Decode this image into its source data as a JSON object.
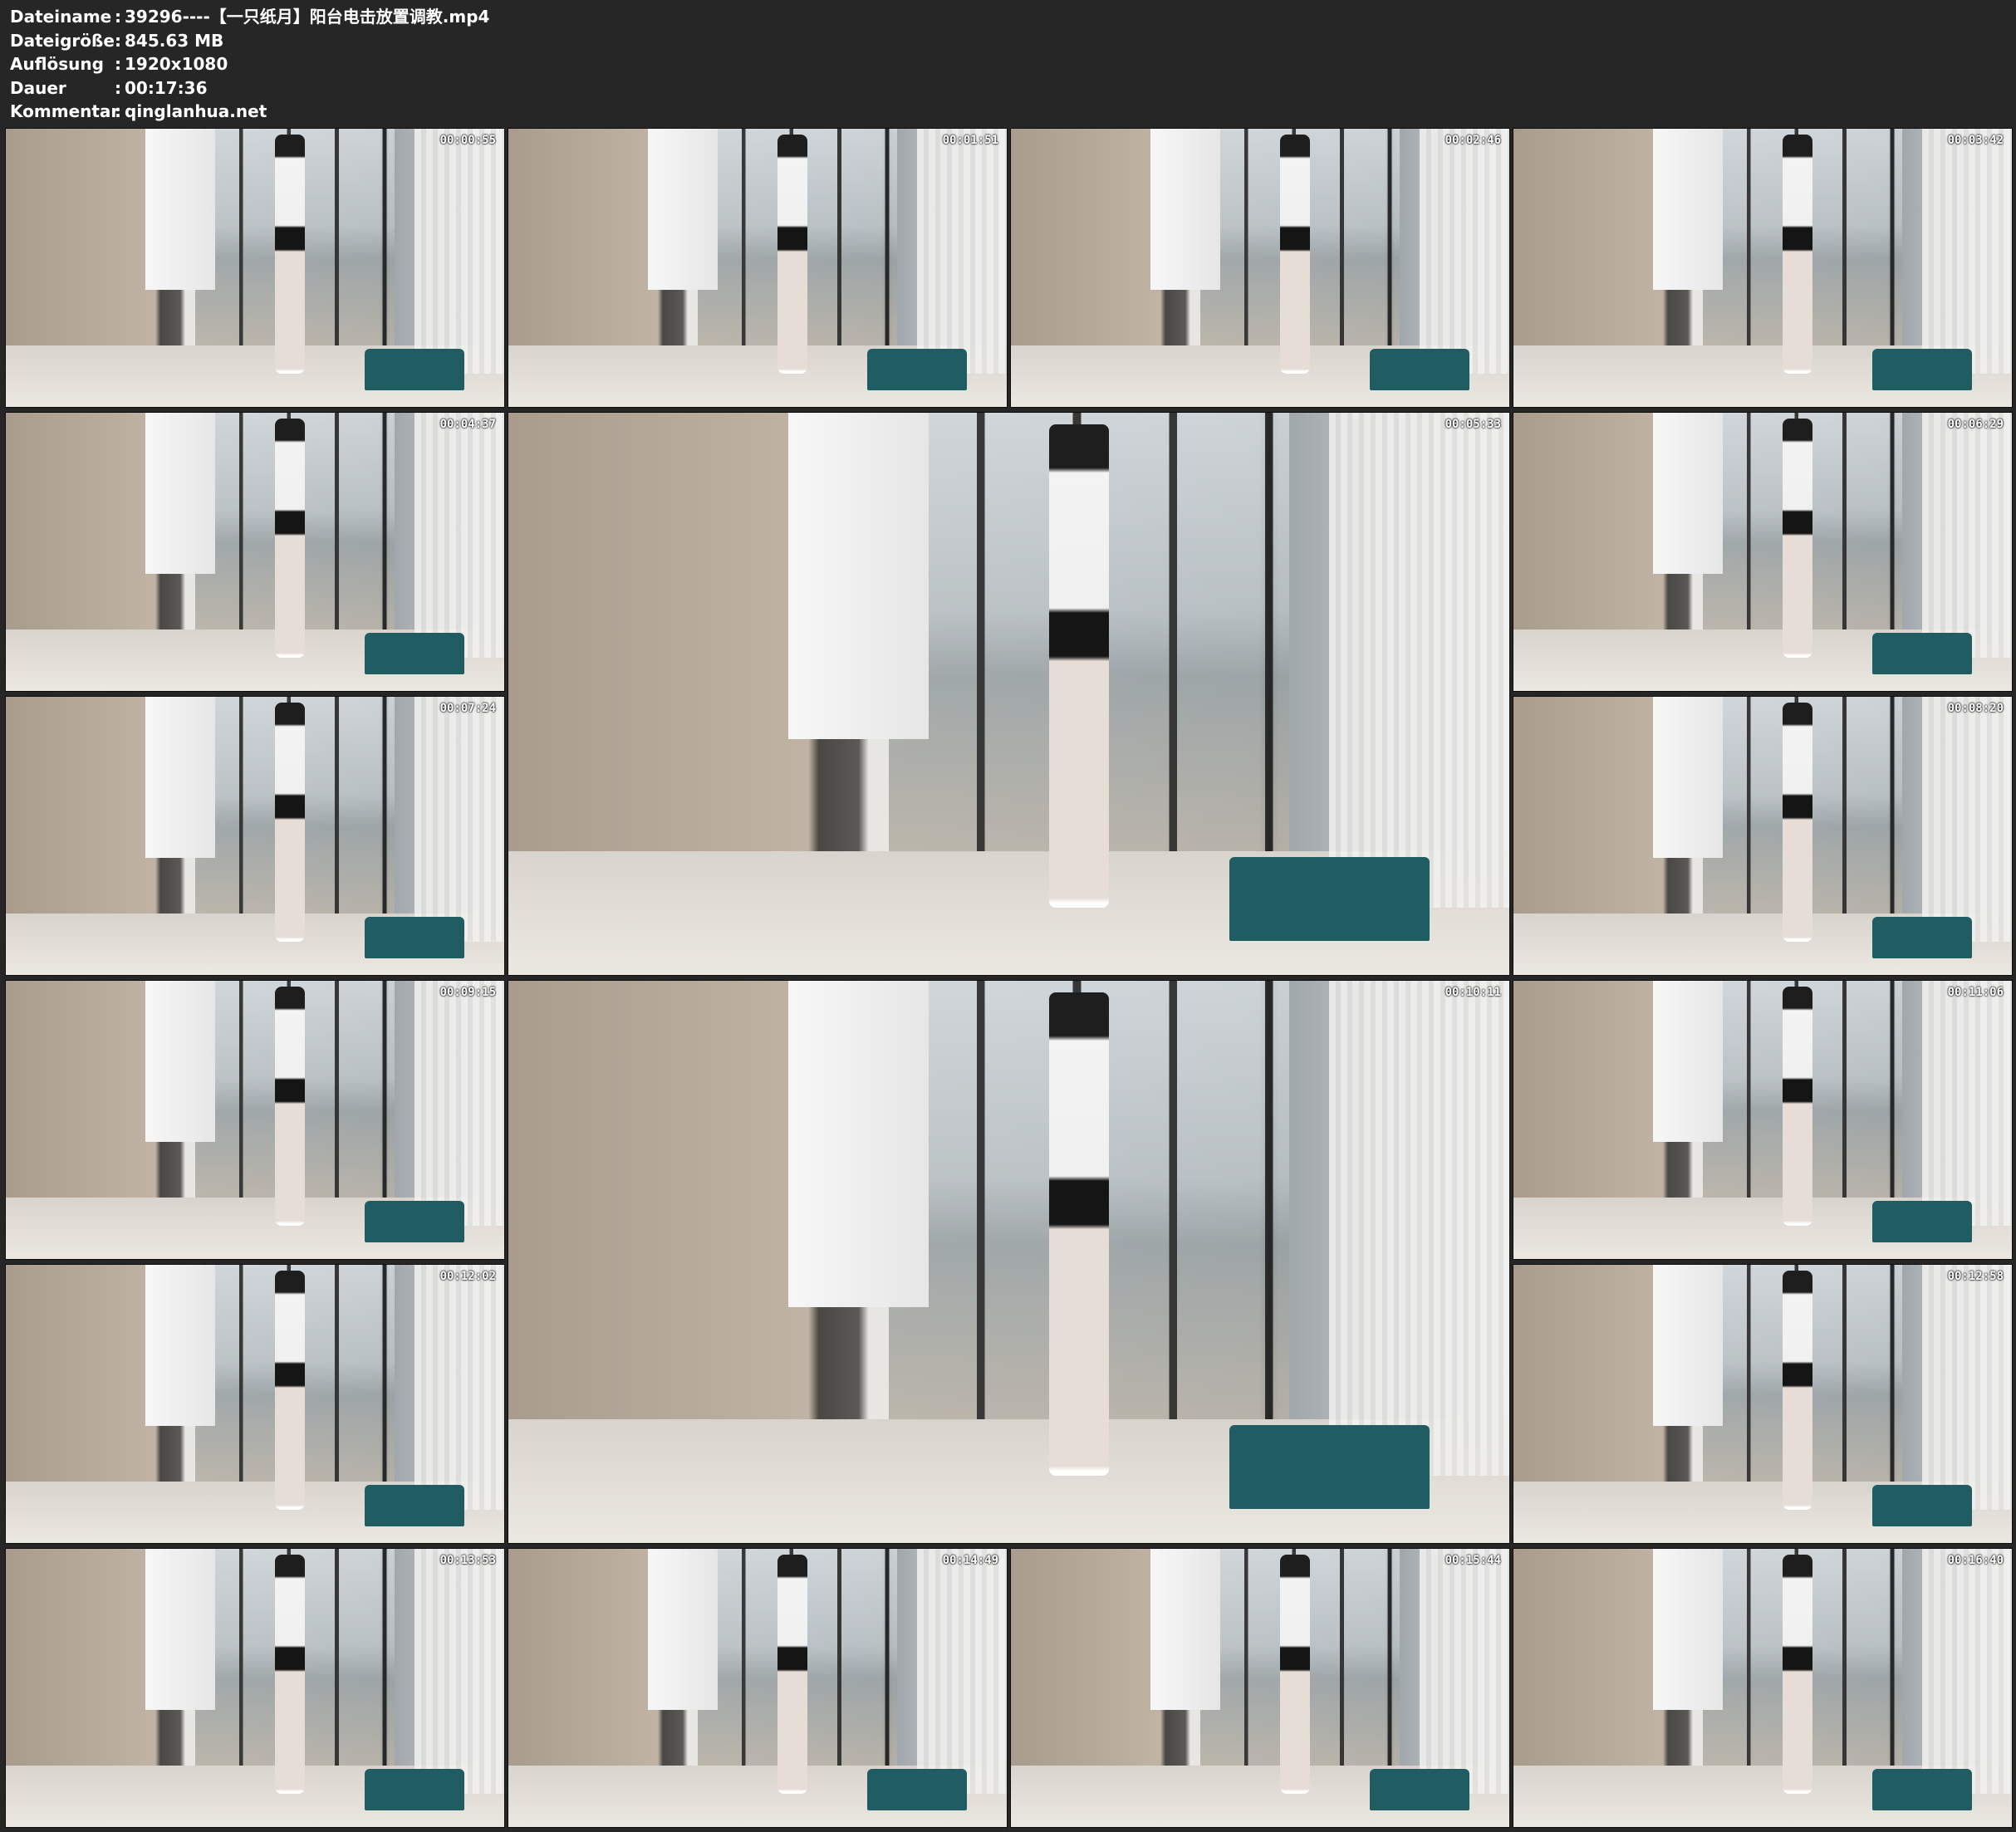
{
  "file_info": [
    {
      "key": "Dateiname",
      "sep": ":",
      "value": "39296----【一只纸月】阳台电击放置调教.mp4"
    },
    {
      "key": "Dateigröße",
      "sep": ":",
      "value": "845.63 MB"
    },
    {
      "key": "Auflösung",
      "sep": ":",
      "value": "1920x1080"
    },
    {
      "key": "Dauer",
      "sep": ":",
      "value": "00:17:36"
    },
    {
      "key": "Kommentar",
      "sep": ":",
      "value": "qinglanhua.net"
    }
  ],
  "thumbnails": [
    {
      "timestamp": "00:00:55"
    },
    {
      "timestamp": "00:01:51"
    },
    {
      "timestamp": "00:02:46"
    },
    {
      "timestamp": "00:03:42"
    },
    {
      "timestamp": "00:04:37"
    },
    {
      "timestamp": "00:05:33"
    },
    {
      "timestamp": "00:06:29"
    },
    {
      "timestamp": "00:07:24"
    },
    {
      "timestamp": "00:08:20"
    },
    {
      "timestamp": "00:09:15"
    },
    {
      "timestamp": "00:10:11"
    },
    {
      "timestamp": "00:11:06"
    },
    {
      "timestamp": "00:12:02"
    },
    {
      "timestamp": "00:12:58"
    },
    {
      "timestamp": "00:13:53"
    },
    {
      "timestamp": "00:14:49"
    },
    {
      "timestamp": "00:15:44"
    },
    {
      "timestamp": "00:16:40"
    }
  ]
}
